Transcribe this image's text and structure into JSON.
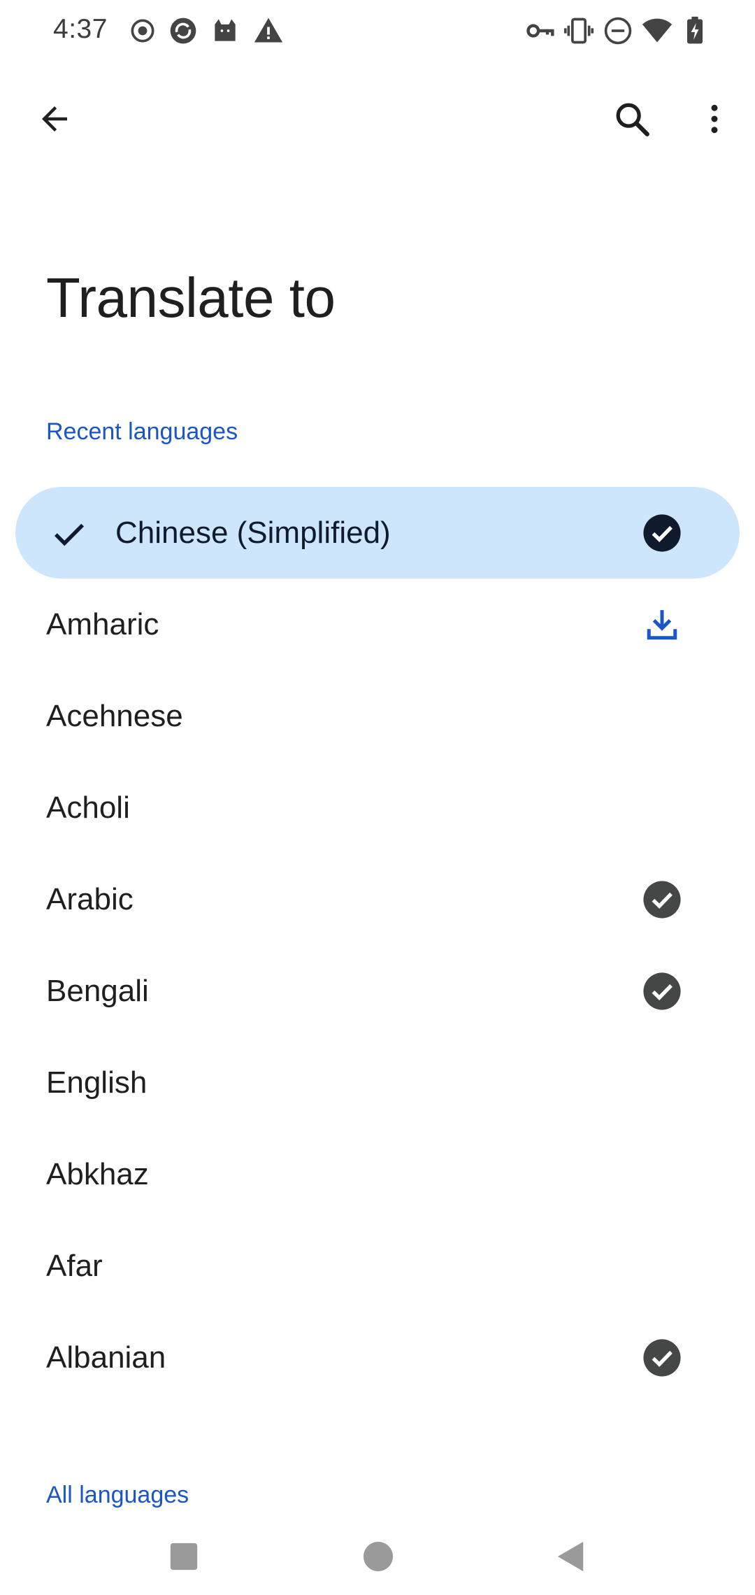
{
  "status_bar": {
    "time": "4:37",
    "left_icons": [
      "record-icon",
      "app-sync-icon",
      "cat-icon",
      "warning-icon"
    ],
    "right_icons": [
      "vpn-key-icon",
      "vibrate-icon",
      "do-not-disturb-icon",
      "wifi-icon",
      "battery-charging-icon"
    ]
  },
  "app_bar": {
    "icons": [
      "back-arrow-icon",
      "search-icon",
      "more-vert-icon"
    ]
  },
  "page": {
    "title": "Translate to"
  },
  "sections": {
    "recent": "Recent languages",
    "all": "All languages"
  },
  "languages": [
    {
      "label": "Chinese (Simplified)",
      "selected": true,
      "status": "downloaded"
    },
    {
      "label": "Amharic",
      "selected": false,
      "status": "download"
    },
    {
      "label": "Acehnese",
      "selected": false,
      "status": "none"
    },
    {
      "label": "Acholi",
      "selected": false,
      "status": "none"
    },
    {
      "label": "Arabic",
      "selected": false,
      "status": "downloaded"
    },
    {
      "label": "Bengali",
      "selected": false,
      "status": "downloaded"
    },
    {
      "label": "English",
      "selected": false,
      "status": "none"
    },
    {
      "label": "Abkhaz",
      "selected": false,
      "status": "none"
    },
    {
      "label": "Afar",
      "selected": false,
      "status": "none"
    },
    {
      "label": "Albanian",
      "selected": false,
      "status": "downloaded"
    }
  ],
  "colors": {
    "accent": "#1a56c8",
    "selected_bg": "#cde6fb",
    "selected_check_bg": "#0f1b2d",
    "downloaded_bg": "#444746",
    "text": "#1f1f1f"
  },
  "nav_bar": {
    "icons": [
      "recents-square-icon",
      "home-circle-icon",
      "back-triangle-icon"
    ]
  }
}
